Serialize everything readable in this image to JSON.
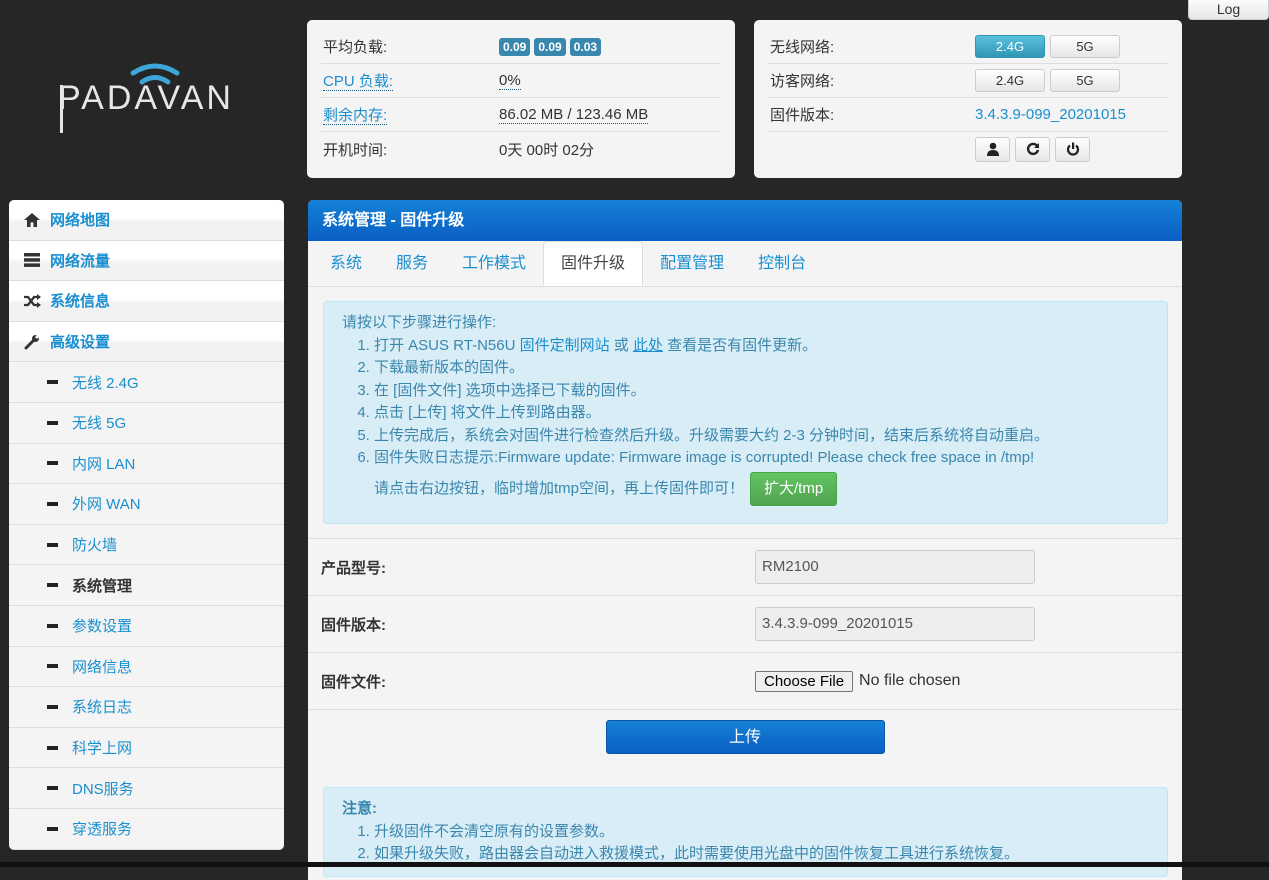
{
  "log_button": "Log",
  "logo_text": "PADAVAN",
  "status": {
    "rows": [
      {
        "label": "平均负载:",
        "badges": [
          "0.09",
          "0.09",
          "0.03"
        ]
      },
      {
        "label": "CPU 负载:",
        "value": "0%"
      },
      {
        "label": "剩余内存:",
        "value": "86.02 MB / 123.46 MB"
      },
      {
        "label": "开机时间:",
        "value": "0天 00时 02分"
      }
    ]
  },
  "network": {
    "wireless_label": "无线网络:",
    "guest_label": "访客网络:",
    "firmware_label": "固件版本:",
    "band_24": "2.4G",
    "band_5": "5G",
    "firmware_version": "3.4.3.9-099_20201015"
  },
  "sidebar": {
    "nav": [
      {
        "label": "网络地图",
        "icon": "home-icon"
      },
      {
        "label": "网络流量",
        "icon": "list-icon"
      },
      {
        "label": "系统信息",
        "icon": "shuffle-icon"
      },
      {
        "label": "高级设置",
        "icon": "wrench-icon"
      }
    ],
    "sub": [
      "无线 2.4G",
      "无线 5G",
      "内网 LAN",
      "外网 WAN",
      "防火墙",
      "系统管理",
      "参数设置",
      "网络信息",
      "系统日志",
      "科学上网",
      "DNS服务",
      "穿透服务"
    ],
    "active": "系统管理"
  },
  "main": {
    "title": "系统管理 - 固件升级",
    "tabs": [
      "系统",
      "服务",
      "工作模式",
      "固件升级",
      "配置管理",
      "控制台"
    ],
    "active_tab": "固件升级",
    "intro": "请按以下步骤进行操作:",
    "step1_a": "打开 ASUS RT-N56U ",
    "step1_link1": "固件定制网站",
    "step1_b": " 或 ",
    "step1_link2": "此处",
    "step1_c": " 查看是否有固件更新。",
    "step2": "下载最新版本的固件。",
    "step3": "在 [固件文件] 选项中选择已下载的固件。",
    "step4": "点击 [上传] 将文件上传到路由器。",
    "step5": "上传完成后，系统会对固件进行检查然后升级。升级需要大约 2-3 分钟时间，结束后系统将自动重启。",
    "step6": "固件失败日志提示:Firmware update: Firmware image is corrupted! Please check free space in /tmp!",
    "step6_hint": "请点击右边按钮，临时增加tmp空间，再上传固件即可！",
    "expand_button": "扩大/tmp",
    "product_label": "产品型号:",
    "product_value": "RM2100",
    "fw_label": "固件版本:",
    "fw_value": "3.4.3.9-099_20201015",
    "file_label": "固件文件:",
    "choose_file": "Choose File",
    "no_file": "No file chosen",
    "upload_button": "上传",
    "note_title": "注意:",
    "note1": "升级固件不会清空原有的设置参数。",
    "note2": "如果升级失败，路由器会自动进入救援模式，此时需要使用光盘中的固件恢复工具进行系统恢复。"
  }
}
